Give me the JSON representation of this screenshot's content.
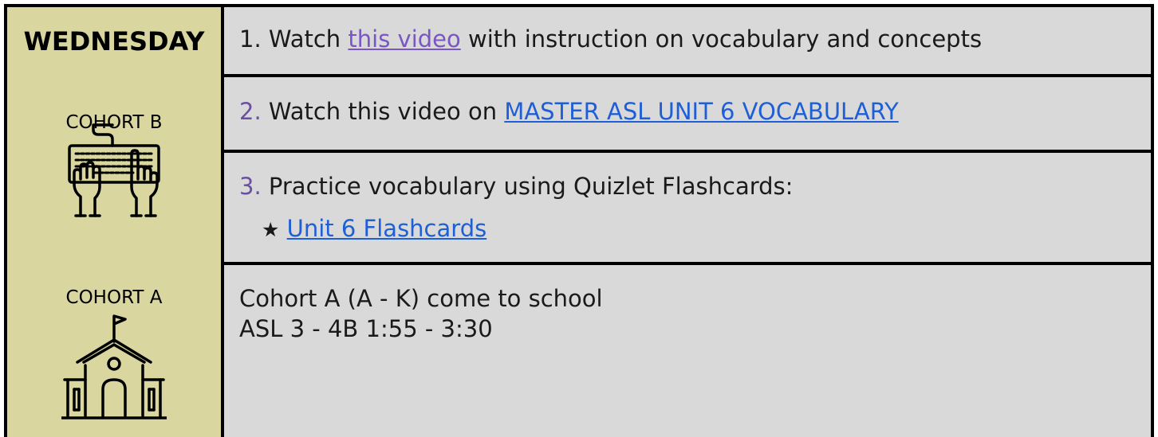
{
  "day": {
    "title": "WEDNESDAY"
  },
  "cohort_b": {
    "label": "COHORT B",
    "icon": "keyboard-hands-icon"
  },
  "cohort_a": {
    "label": "COHORT A",
    "icon": "school-building-icon"
  },
  "tasks": {
    "item1": {
      "number": "1.",
      "prefix": "Watch",
      "link": "this video",
      "suffix": "with instruction on vocabulary and concepts"
    },
    "item2": {
      "number": "2.",
      "prefix": "Watch this video on",
      "link": "MASTER ASL UNIT 6 VOCABULARY"
    },
    "item3": {
      "number": "3.",
      "text": "Practice vocabulary using Quizlet Flashcards:",
      "bullet": "★",
      "link": "Unit 6 Flashcards"
    }
  },
  "cohort_a_info": {
    "line1": "Cohort A (A - K) come to school",
    "line2": "ASL 3 - 4B 1:55 - 3:30"
  },
  "colors": {
    "left_bg": "#d9d6a0",
    "cell_bg": "#d9d9d9",
    "link_blue": "#1f5fd6",
    "link_purple": "#7a56c4",
    "number_purple": "#6b4fa0"
  }
}
